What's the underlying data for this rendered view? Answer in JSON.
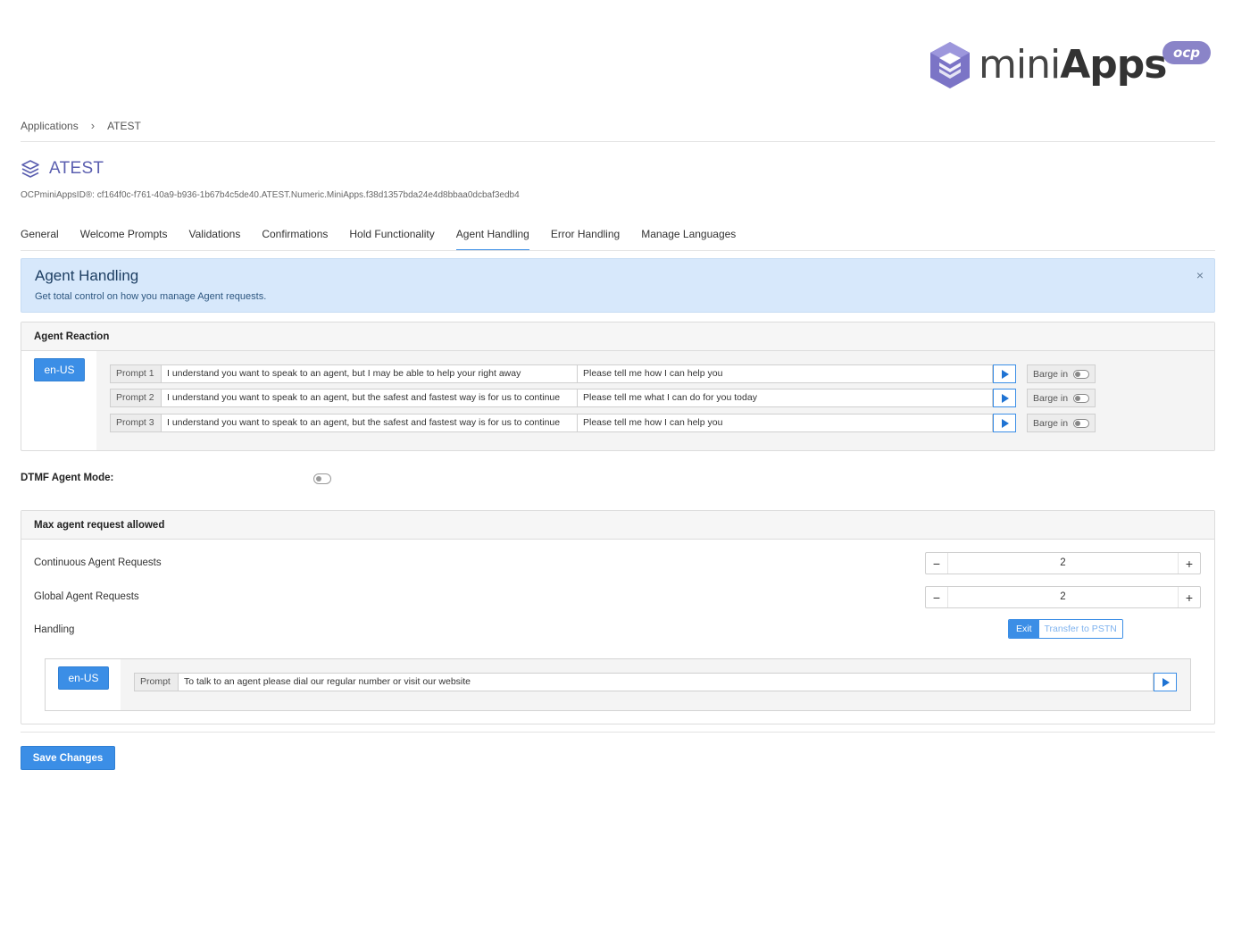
{
  "logo": {
    "word_light": "mini",
    "word_bold": "Apps",
    "badge": "ocp"
  },
  "breadcrumb": {
    "root": "Applications",
    "separator": "›",
    "current": "ATEST"
  },
  "app": {
    "title": "ATEST",
    "id_line": "OCPminiAppsID®: cf164f0c-f761-40a9-b936-1b67b4c5de40.ATEST.Numeric.MiniApps.f38d1357bda24e4d8bbaa0dcbaf3edb4"
  },
  "tabs": [
    {
      "label": "General"
    },
    {
      "label": "Welcome Prompts"
    },
    {
      "label": "Validations"
    },
    {
      "label": "Confirmations"
    },
    {
      "label": "Hold Functionality"
    },
    {
      "label": "Agent Handling",
      "active": true
    },
    {
      "label": "Error Handling"
    },
    {
      "label": "Manage Languages"
    }
  ],
  "banner": {
    "title": "Agent Handling",
    "subtitle": "Get total control on how you manage Agent requests.",
    "close": "×"
  },
  "agent_reaction": {
    "header": "Agent Reaction",
    "language": "en-US",
    "prompts": [
      {
        "label": "Prompt 1",
        "text": "I understand you want to speak to an agent, but I may be able to help your right away",
        "followup": "Please tell me how I can help you",
        "barge_label": "Barge in",
        "barge_on": false
      },
      {
        "label": "Prompt 2",
        "text": "I understand you want to speak to an agent, but the safest and fastest way is for us to continue",
        "followup": "Please tell me what I can do for you today",
        "barge_label": "Barge in",
        "barge_on": false
      },
      {
        "label": "Prompt 3",
        "text": "I understand you want to speak to an agent, but the safest and fastest way is for us to continue",
        "followup": "Please tell me how I can help you",
        "barge_label": "Barge in",
        "barge_on": false
      }
    ]
  },
  "dtmf": {
    "label": "DTMF Agent Mode:",
    "enabled": false
  },
  "max_agent": {
    "header": "Max agent request allowed",
    "continuous_label": "Continuous Agent Requests",
    "continuous_value": "2",
    "global_label": "Global Agent Requests",
    "global_value": "2",
    "handling_label": "Handling",
    "handling_options": [
      "Exit",
      "Transfer to PSTN"
    ],
    "handling_selected": "Exit",
    "language": "en-US",
    "prompt_label": "Prompt",
    "prompt_text": "To talk to an agent please dial our regular number or visit our website",
    "minus": "−",
    "plus": "+"
  },
  "save_label": "Save Changes",
  "colors": {
    "accent": "#3b8ee6",
    "brand_purple": "#5b5fb0",
    "banner_bg": "#d7e8fb"
  },
  "icons": [
    "layers-icon",
    "chevron-right-icon",
    "close-icon",
    "play-icon",
    "minus-icon",
    "plus-icon"
  ]
}
